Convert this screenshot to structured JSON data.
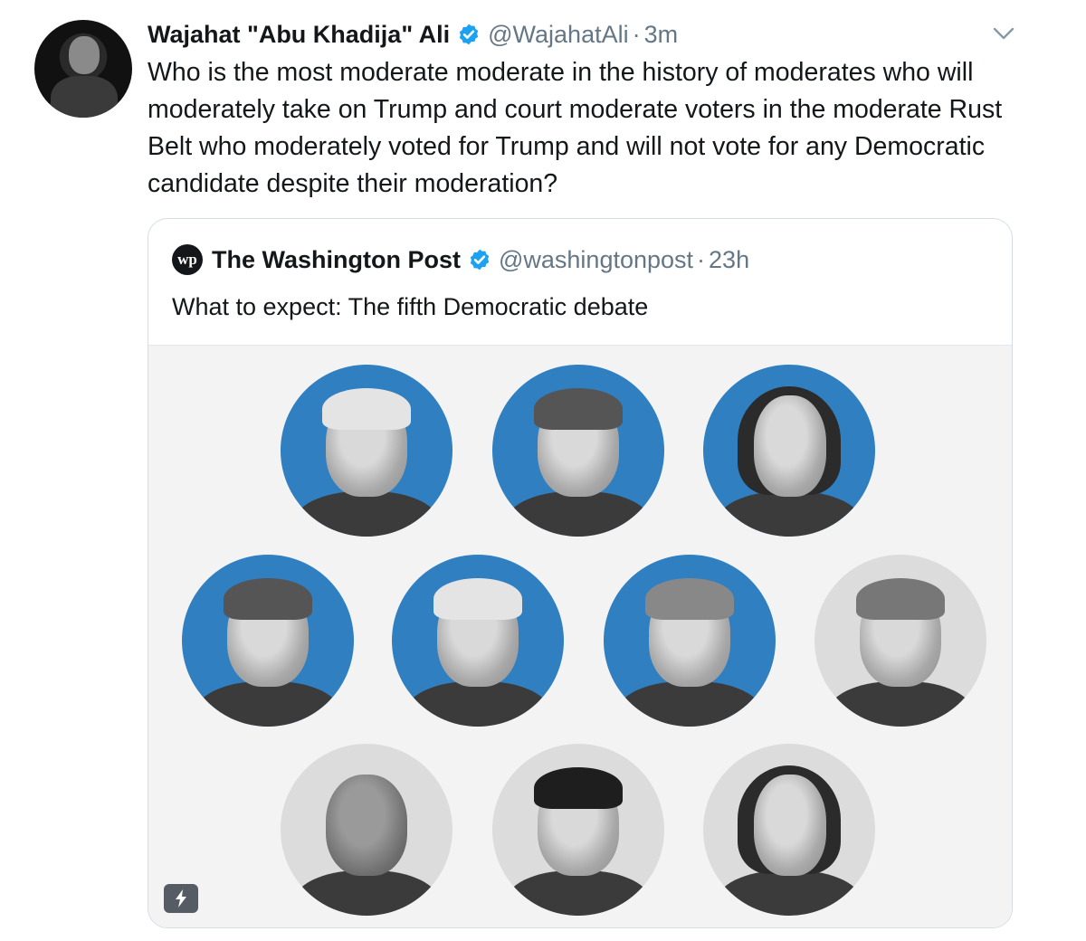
{
  "tweet": {
    "author_name": "Wajahat \"Abu Khadija\" Ali",
    "handle": "@WajahatAli",
    "separator": "·",
    "time": "3m",
    "text": "Who is the most moderate moderate in the history of moderates who will moderately take on Trump and court moderate voters in the moderate Rust Belt who moderately voted for Trump and will not vote for any Democratic candidate despite their moderation?",
    "verified": true,
    "menu_icon": "chevron-down-icon"
  },
  "quoted_tweet": {
    "logo_text": "wp",
    "author_name": "The Washington Post",
    "handle": "@washingtonpost",
    "separator": "·",
    "time": "23h",
    "text": "What to expect: The fifth Democratic debate",
    "verified": true,
    "media_badge_icon": "lightning-bolt-icon"
  },
  "colors": {
    "accent_blue": "#1da1f2",
    "portrait_blue": "#2f7fc1",
    "secondary_text": "#657786"
  }
}
